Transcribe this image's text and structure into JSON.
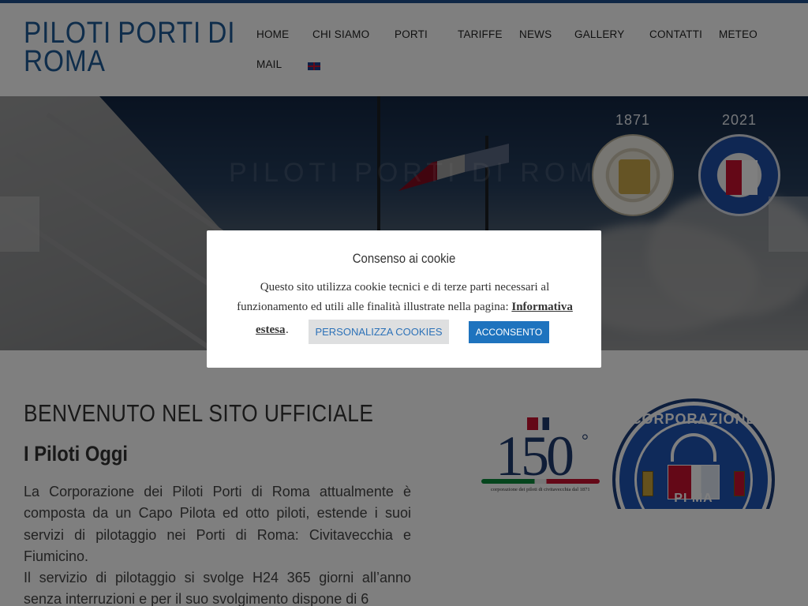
{
  "site": {
    "logo_line1": [
      "PILOTI",
      "PORTI",
      "DI"
    ],
    "logo_line2": "ROMA"
  },
  "nav": {
    "items": [
      {
        "label": "HOME"
      },
      {
        "label": "CHI SIAMO"
      },
      {
        "label": "PORTI"
      },
      {
        "label": "TARIFFE"
      },
      {
        "label": "NEWS"
      },
      {
        "label": "GALLERY"
      },
      {
        "label": "CONTATTI"
      },
      {
        "label": "METEO"
      },
      {
        "label": "MAIL"
      }
    ],
    "language_flag": "uk-flag-icon"
  },
  "hero": {
    "year_left": "1871",
    "year_right": "2021",
    "watermark": "PILOTI PORTI DI ROMA",
    "seal_left": "anniversary-seal-icon",
    "seal_right": "corporazione-seal-icon"
  },
  "main": {
    "title": "BENVENUTO NEL SITO UFFICIALE",
    "subtitle": "I Piloti Oggi",
    "paragraphs": [
      "La Corporazione dei Piloti Porti di Roma attualmente è composta da un Capo Pilota  ed otto piloti, estende i suoi servizi di pilotaggio nei Porti di Roma: Civitavecchia e Fiumicino.",
      "Il servizio di pilotaggio si svolge H24  365 giorni all’anno senza interruzioni e per il suo svolgimento dispone di  6"
    ]
  },
  "side_logo": {
    "number": "150",
    "sup": "°",
    "caption": "corporazione dei piloti di civitavecchia dal 1871",
    "seal_top": "CORPORAZIONE",
    "seal_bottom": "PI                    MA"
  },
  "cookie": {
    "title": "Consenso ai cookie",
    "text": "Questo sito utilizza cookie tecnici e di terze parti necessari al funzionamento ed utili alle finalità illustrate nella pagina: ",
    "link_part1": "Informativa",
    "link_part2": "estesa",
    "dot": ".",
    "customize_label": "PERSONALIZZA COOKIES",
    "accept_label": "ACCONSENTO"
  },
  "colors": {
    "brand": "#1f5a96",
    "accent_button": "#1e73be",
    "top_bar": "#1f4e8c"
  }
}
